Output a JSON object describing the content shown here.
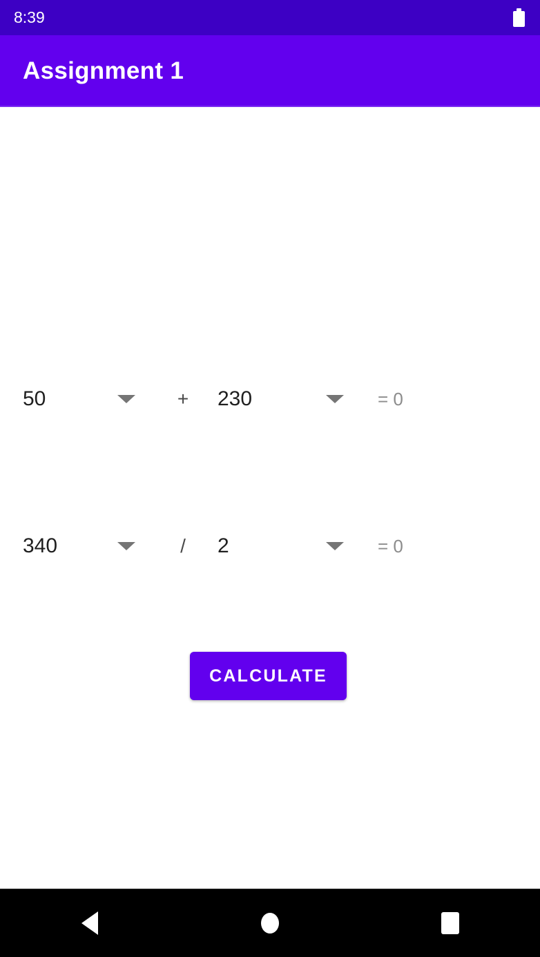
{
  "status_bar": {
    "time": "8:39",
    "battery_icon": "battery-full-icon",
    "background_color": "#3d00c4"
  },
  "app_bar": {
    "title": "Assignment 1",
    "background_color": "#6200ee",
    "text_color": "#ffffff"
  },
  "calculations": [
    {
      "operand_a": "50",
      "operator": "+",
      "operand_b": "230",
      "result_label": "= 0",
      "dropdown_icon": "chevron-down-icon"
    },
    {
      "operand_a": "340",
      "operator": "/",
      "operand_b": "2",
      "result_label": "= 0",
      "dropdown_icon": "chevron-down-icon"
    }
  ],
  "calculate_button": {
    "label": "CALCULATE",
    "background_color": "#6200ee",
    "text_color": "#ffffff"
  },
  "navigation_bar": {
    "back_icon": "triangle-back-icon",
    "home_icon": "circle-home-icon",
    "recents_icon": "square-recents-icon",
    "background_color": "#000000"
  }
}
